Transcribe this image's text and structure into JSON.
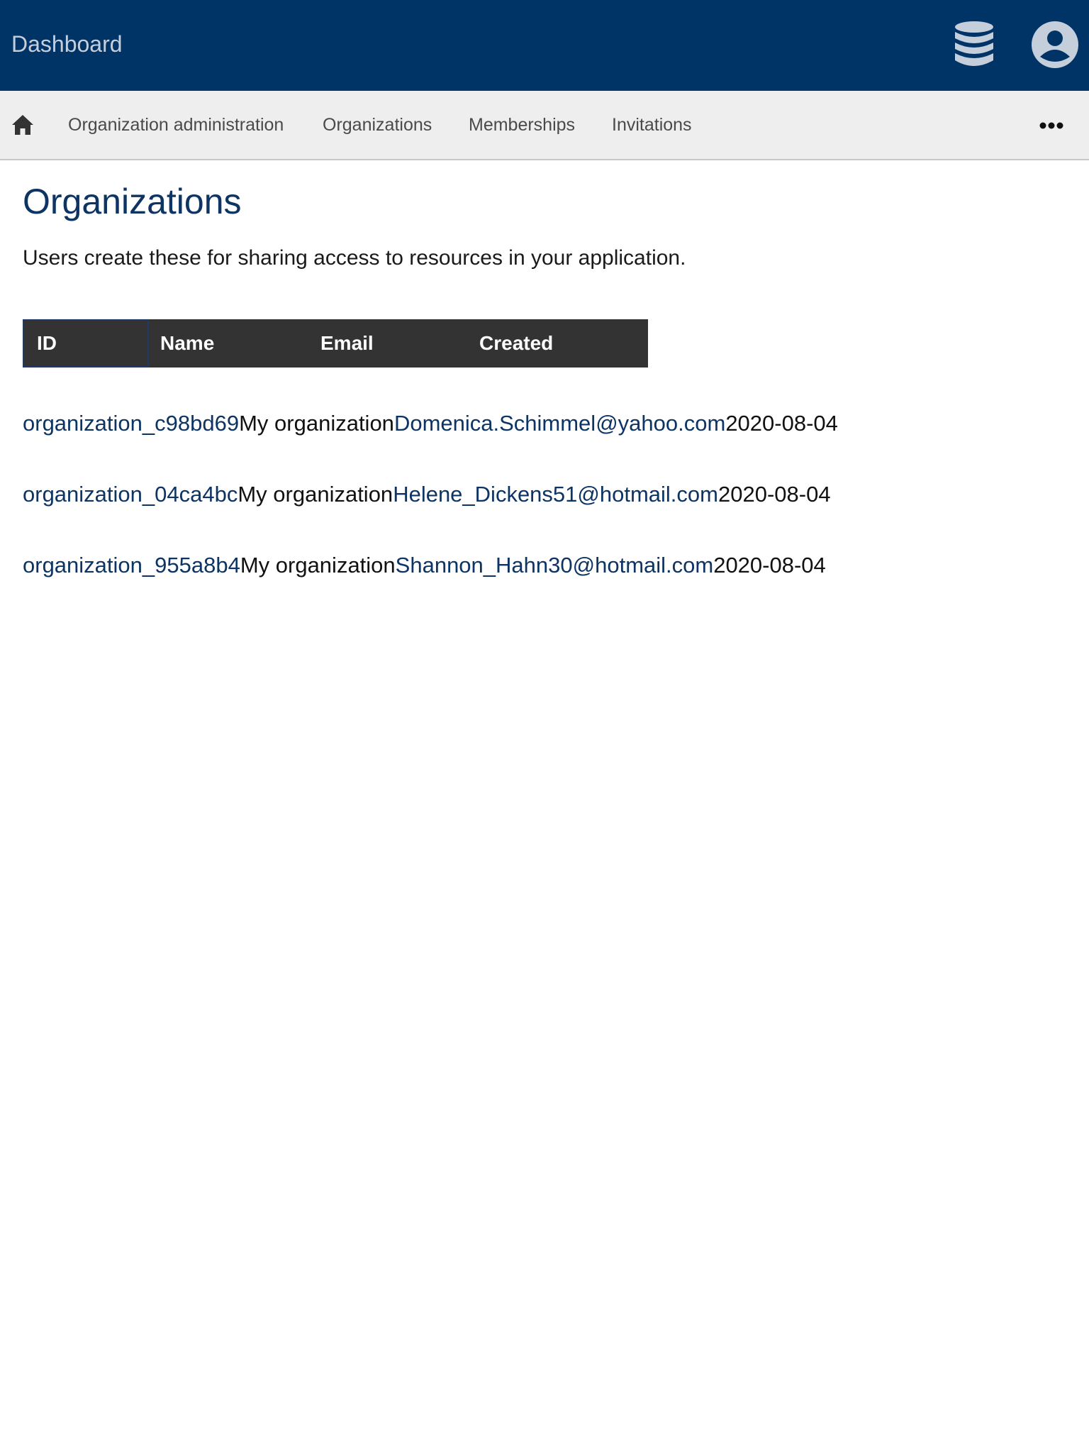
{
  "header": {
    "title": "Dashboard",
    "icons": {
      "database": "database-icon",
      "account": "account-circle-icon"
    },
    "background": "#003366"
  },
  "subnav": {
    "home_icon": "home-icon",
    "links": [
      {
        "label": "Organization administration"
      },
      {
        "label": "Organizations"
      },
      {
        "label": "Memberships"
      },
      {
        "label": "Invitations"
      }
    ],
    "more_icon": "more-horizontal-icon"
  },
  "page": {
    "title": "Organizations",
    "description": "Users create these for sharing access to resources in your application."
  },
  "table": {
    "columns": [
      "ID",
      "Name",
      "Email",
      "Created"
    ],
    "rows": [
      {
        "id": "organization_c98bd69",
        "name": "My organization",
        "email": "Domenica.Schimmel@yahoo.com",
        "created": "2020-08-04"
      },
      {
        "id": "organization_04ca4bc",
        "name": "My organization",
        "email": "Helene_Dickens51@hotmail.com",
        "created": "2020-08-04"
      },
      {
        "id": "organization_955a8b4",
        "name": "My organization",
        "email": "Shannon_Hahn30@hotmail.com",
        "created": "2020-08-04"
      }
    ]
  },
  "colors": {
    "accent": "#0d3462",
    "header_bg": "#003366",
    "subnav_bg": "#eeeeee",
    "table_header_bg": "#333333"
  }
}
